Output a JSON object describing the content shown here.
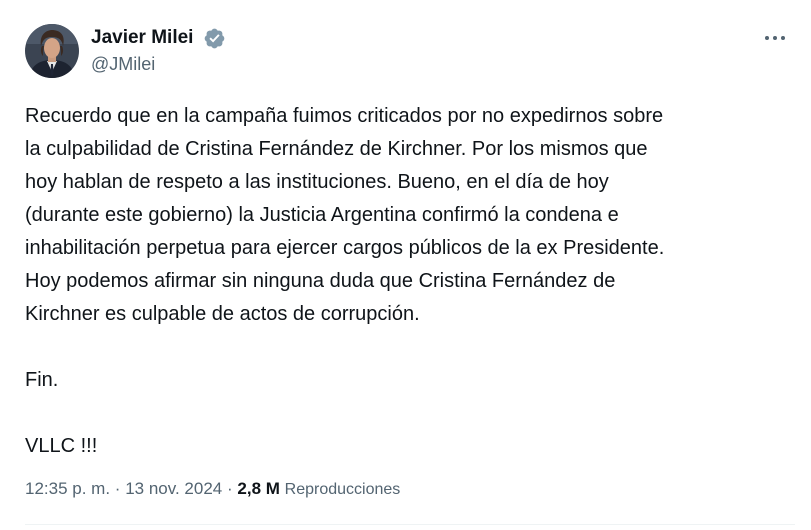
{
  "author": {
    "display_name": "Javier Milei",
    "handle": "@JMilei",
    "verified_badge_color": "#829aab"
  },
  "post": {
    "lines": [
      "Recuerdo que en la campaña fuimos criticados por no expedirnos sobre",
      "la culpabilidad de Cristina Fernández de Kirchner. Por los mismos que",
      "hoy hablan de respeto a las instituciones. Bueno, en el día de hoy",
      "(durante este gobierno) la Justicia Argentina confirmó la condena e",
      "inhabilitación perpetua para ejercer cargos públicos de la ex Presidente.",
      "Hoy podemos afirmar sin ninguna duda que Cristina Fernández de",
      "Kirchner es culpable de actos de corrupción."
    ],
    "closing_1": "Fin.",
    "closing_2": "VLLC !!!"
  },
  "meta": {
    "time": "12:35 p. m.",
    "separator": "·",
    "date": "13 nov. 2024",
    "views_count": "2,8 M",
    "views_label": "Reproducciones"
  },
  "icons": {
    "more": "more-options-icon",
    "verified": "verified-badge-icon"
  }
}
